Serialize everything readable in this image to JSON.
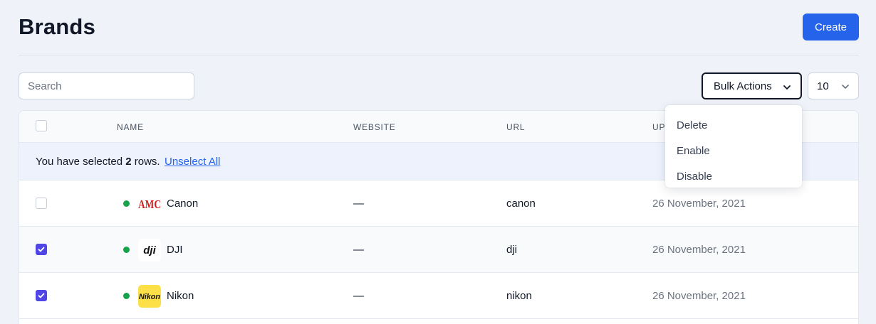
{
  "header": {
    "title": "Brands",
    "create_label": "Create"
  },
  "toolbar": {
    "search_placeholder": "Search",
    "bulk_label": "Bulk Actions",
    "per_page": "10"
  },
  "table": {
    "columns": {
      "name": "Name",
      "website": "Website",
      "url": "URL",
      "updated": "Up"
    },
    "selection": {
      "prefix": "You have selected",
      "count": "2",
      "suffix": "rows.",
      "unselect_label": "Unselect All"
    },
    "rows": [
      {
        "name": "Canon",
        "website": "—",
        "url": "canon",
        "updated": "26 November, 2021",
        "checked": false,
        "status": "active",
        "logo_text": "AMC",
        "logo_color": "#d11d1d"
      },
      {
        "name": "DJI",
        "website": "—",
        "url": "dji",
        "updated": "26 November, 2021",
        "checked": true,
        "status": "active",
        "logo_text": "dji",
        "logo_color": "#111111"
      },
      {
        "name": "Nikon",
        "website": "—",
        "url": "nikon",
        "updated": "26 November, 2021",
        "checked": true,
        "status": "active",
        "logo_text": "Nikon",
        "logo_color": "#111111"
      }
    ]
  },
  "bulk_menu": {
    "items": [
      "Delete",
      "Enable",
      "Disable"
    ]
  },
  "colors": {
    "accent": "#2563eb",
    "checkbox": "#4f46e5",
    "status_active": "#16a34a",
    "nikon_yellow": "#fde047"
  },
  "icons": {
    "dropdown": "chevron-down-icon",
    "check": "check-icon"
  }
}
